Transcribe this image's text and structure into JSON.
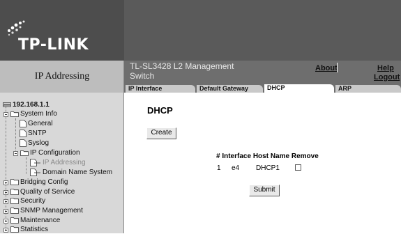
{
  "header": {
    "brand": "TP-LINK",
    "section_title": "IP Addressing",
    "product_line1": "TL-SL3428 L2 Management",
    "product_line2": "Switch",
    "about": "About",
    "help": "Help",
    "logout": "Logout"
  },
  "tabs": [
    {
      "label": "IP Interface",
      "active": false
    },
    {
      "label": "Default Gateway",
      "active": false
    },
    {
      "label": "DHCP",
      "active": true
    },
    {
      "label": "ARP",
      "active": false
    }
  ],
  "sidebar": {
    "root": "192.168.1.1",
    "items": [
      {
        "label": "System Info"
      },
      {
        "label": "General"
      },
      {
        "label": "SNTP"
      },
      {
        "label": "Syslog"
      },
      {
        "label": "IP Configuration"
      },
      {
        "label": "IP Addressing",
        "selected": true
      },
      {
        "label": "Domain Name System"
      },
      {
        "label": "Bridging Config"
      },
      {
        "label": "Quality of Service"
      },
      {
        "label": "Security"
      },
      {
        "label": "SNMP Management"
      },
      {
        "label": "Maintenance"
      },
      {
        "label": "Statistics"
      }
    ]
  },
  "main": {
    "title": "DHCP",
    "create_label": "Create",
    "table": {
      "headers": [
        "#",
        "Interface",
        "Host Name",
        "Remove"
      ],
      "rows": [
        {
          "num": "1",
          "interface": "e4",
          "host": "DHCP1",
          "remove": false
        }
      ]
    },
    "submit_label": "Submit"
  },
  "colors": {
    "header_bg": "#5a5a5a",
    "band_bg": "#6e6e6e",
    "sidebar_bg": "#d8d8d8",
    "selected_text": "#8a8a8a"
  }
}
